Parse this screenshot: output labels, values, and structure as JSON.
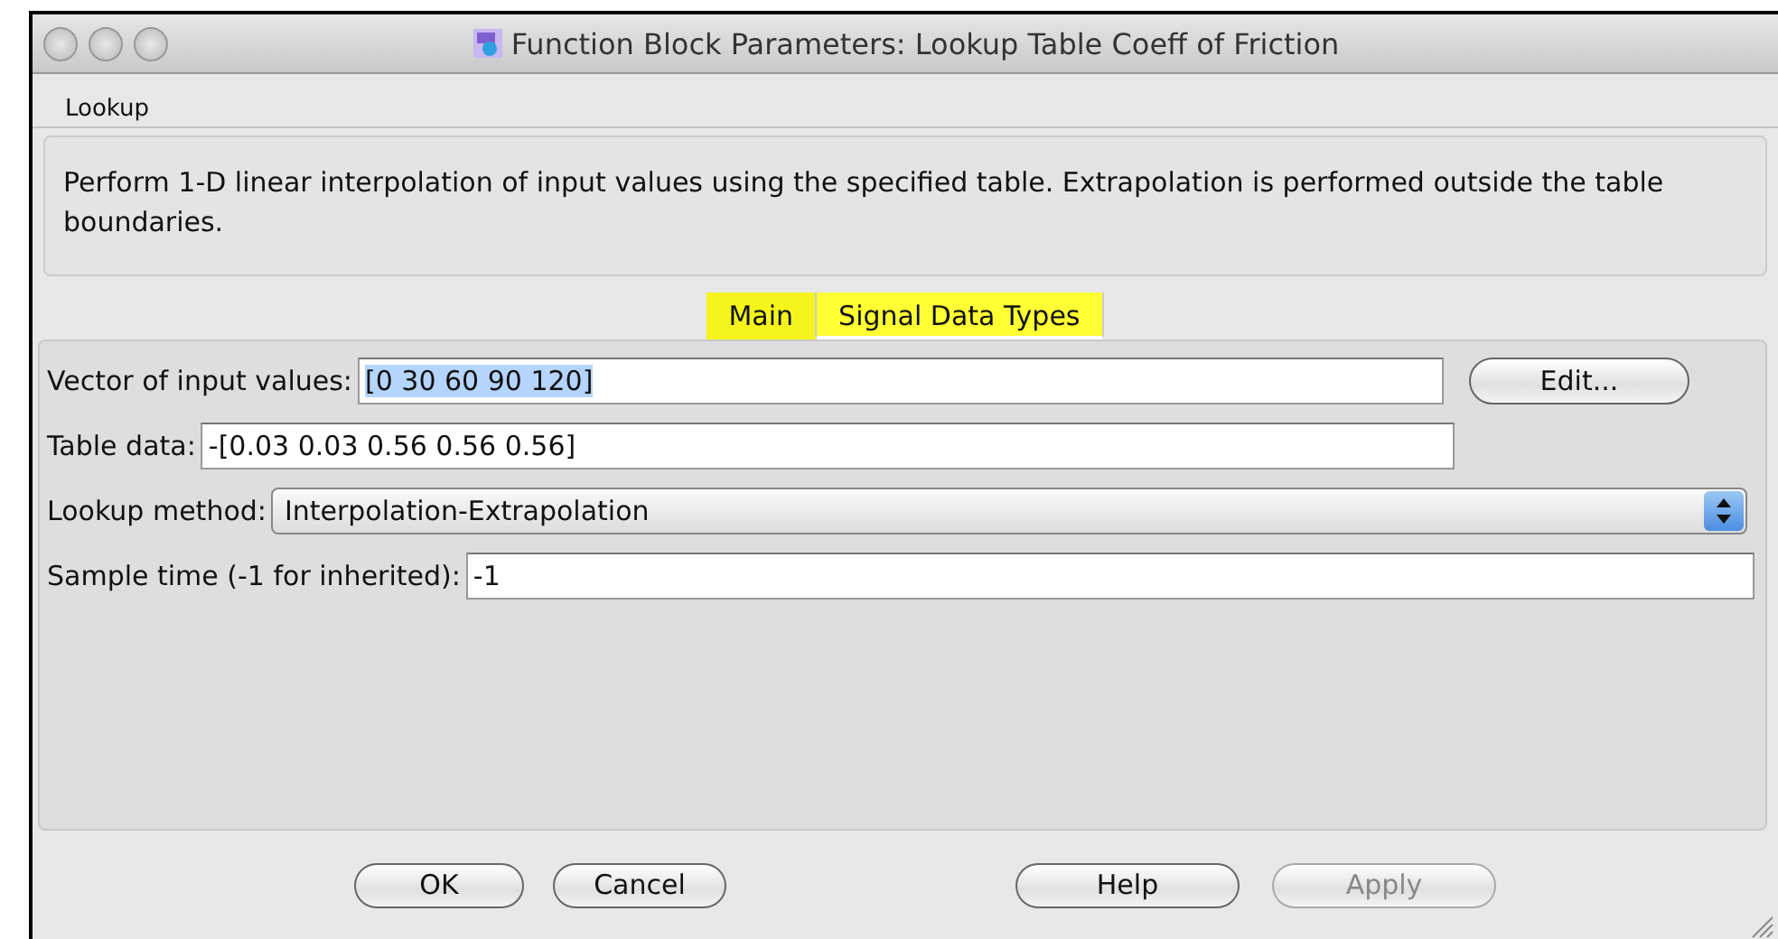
{
  "window": {
    "title": "Function Block Parameters: Lookup Table Coeff of Friction"
  },
  "block_type": "Lookup",
  "description": "Perform 1-D linear interpolation of input values using the specified table.  Extrapolation is performed outside the table boundaries.",
  "tabs": [
    {
      "label": "Main",
      "selected": true
    },
    {
      "label": "Signal Data Types",
      "selected": false
    }
  ],
  "parameters": [
    {
      "kind": "text",
      "label": "Vector of input values:",
      "value": "[0 30 60 90 120]",
      "text_selected": true,
      "button": "Edit..."
    },
    {
      "kind": "text",
      "label": "Table data:",
      "value": "-[0.03 0.03 0.56 0.56 0.56]",
      "text_selected": false
    },
    {
      "kind": "select",
      "label": "Lookup method:",
      "value": "Interpolation-Extrapolation"
    },
    {
      "kind": "text",
      "label": "Sample time (-1 for inherited):",
      "value": "-1",
      "text_selected": false
    }
  ],
  "buttons": [
    {
      "label": "OK",
      "disabled": false
    },
    {
      "label": "Cancel",
      "disabled": false
    },
    {
      "label": "Help",
      "disabled": false
    },
    {
      "label": "Apply",
      "disabled": true
    }
  ]
}
